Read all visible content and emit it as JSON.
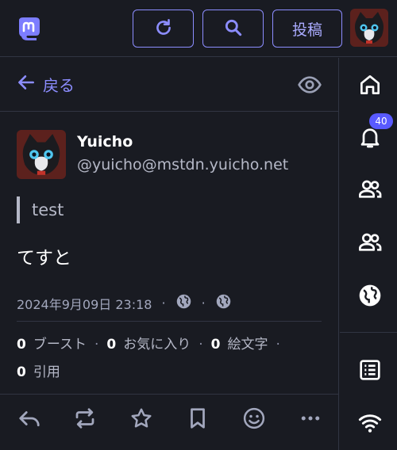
{
  "topbar": {
    "post_label": "投稿"
  },
  "back": {
    "label": "戻る"
  },
  "status": {
    "display_name": "Yuicho",
    "acct": "@yuicho@mstdn.yuicho.net",
    "quote_text": "test",
    "content": "てすと",
    "timestamp": "2024年9月09日 23:18",
    "meta_sep": "·",
    "stats": {
      "boosts_count": "0",
      "boosts_label": "ブースト",
      "favs_count": "0",
      "favs_label": "お気に入り",
      "emoji_count": "0",
      "emoji_label": "絵文字",
      "quotes_count": "0",
      "quotes_label": "引用",
      "sep": "·"
    }
  },
  "sidebar": {
    "notification_count": "40",
    "items": [
      "home-icon",
      "bell-icon",
      "people-icon",
      "people-icon",
      "globe-icon",
      "list-icon",
      "wifi-icon"
    ]
  },
  "colors": {
    "background": "#191b22",
    "accent": "#8c8dff",
    "badge": "#595aff",
    "divider": "#313543"
  }
}
